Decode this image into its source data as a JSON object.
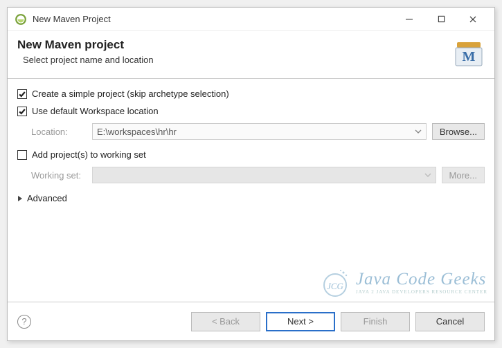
{
  "titlebar": {
    "title": "New Maven Project"
  },
  "header": {
    "title": "New Maven project",
    "subtitle": "Select project name and location"
  },
  "content": {
    "simple_project_label": "Create a simple project (skip archetype selection)",
    "simple_project_checked": true,
    "default_workspace_label": "Use default Workspace location",
    "default_workspace_checked": true,
    "location_label": "Location:",
    "location_value": "E:\\workspaces\\hr\\hr",
    "browse_label": "Browse...",
    "add_working_set_label": "Add project(s) to working set",
    "add_working_set_checked": false,
    "working_set_label": "Working set:",
    "working_set_value": "",
    "more_label": "More...",
    "advanced_label": "Advanced"
  },
  "watermark": {
    "line1": "Java Code Geeks",
    "line2": "JAVA 2 JAVA DEVELOPERS RESOURCE CENTER"
  },
  "footer": {
    "back": "< Back",
    "next": "Next >",
    "finish": "Finish",
    "cancel": "Cancel"
  }
}
